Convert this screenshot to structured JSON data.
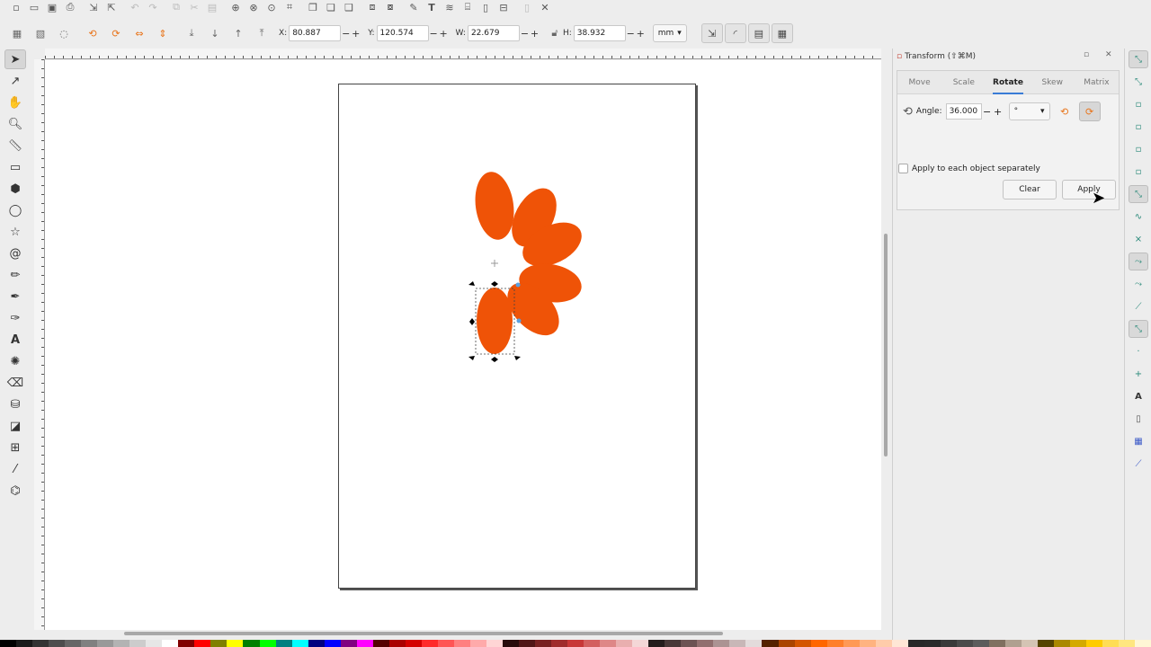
{
  "command_bar": {
    "icons": [
      "new-document-icon",
      "open-icon",
      "save-icon",
      "print-icon",
      "import-icon",
      "export-icon",
      "undo-icon",
      "redo-icon",
      "copy-icon",
      "cut-icon",
      "paste-icon",
      "zoom-selection-icon",
      "zoom-drawing-icon",
      "zoom-page-icon",
      "zoom-fit-icon",
      "duplicate-icon",
      "clone-icon",
      "unlink-clone-icon",
      "group-icon",
      "ungroup-icon",
      "xml-editor-icon",
      "text-font-icon",
      "layers-icon",
      "objects-icon",
      "fill-stroke-icon",
      "align-distribute-icon",
      "preferences-icon",
      "document-properties-icon"
    ]
  },
  "control_bar": {
    "x_label": "X:",
    "x_value": "80.887",
    "y_label": "Y:",
    "y_value": "120.574",
    "w_label": "W:",
    "w_value": "22.679",
    "h_label": "H:",
    "h_value": "38.932",
    "unit": "mm",
    "minus": "−",
    "plus": "+",
    "dropdown": "▾"
  },
  "transform_dialog": {
    "title": "Transform (⇧⌘M)",
    "tabs": [
      "Move",
      "Scale",
      "Rotate",
      "Skew",
      "Matrix"
    ],
    "active_tab": "Rotate",
    "angle_label": "Angle:",
    "angle_value": "36.000",
    "angle_unit": "°",
    "apply_separately_label": "Apply to each object separately",
    "clear_label": "Clear",
    "apply_label": "Apply"
  },
  "colors": {
    "shape_fill": "#ef5307",
    "accent": "#3a7cd6"
  },
  "palette": [
    "#000000",
    "#1a1a1a",
    "#333333",
    "#4d4d4d",
    "#666666",
    "#808080",
    "#999999",
    "#b3b3b3",
    "#cccccc",
    "#e6e6e6",
    "#ffffff",
    "#800000",
    "#ff0000",
    "#808000",
    "#ffff00",
    "#008000",
    "#00ff00",
    "#008080",
    "#00ffff",
    "#000080",
    "#0000ff",
    "#800080",
    "#ff00ff",
    "#550000",
    "#aa0000",
    "#d40000",
    "#ff2a2a",
    "#ff5555",
    "#ff8080",
    "#ffaaaa",
    "#ffd5d5",
    "#280b0b",
    "#501616",
    "#782121",
    "#a02c2c",
    "#c83737",
    "#d35f5f",
    "#de8787",
    "#e9afaf",
    "#f4d7d7",
    "#241c1c",
    "#483737",
    "#6c5353",
    "#916f6f",
    "#ac9393",
    "#c8b7b7",
    "#e3dbdb",
    "#552200",
    "#aa4400",
    "#d45500",
    "#ff6600",
    "#ff7f2a",
    "#ff9955",
    "#ffb380",
    "#ffccaa",
    "#ffe6d5",
    "#282828",
    "#2a2a2a",
    "#3a3a3a",
    "#4b4b4b",
    "#5c5c5c",
    "#807060",
    "#b0a090",
    "#d4c4b4",
    "#554400",
    "#aa8800",
    "#d4aa00",
    "#ffcc00",
    "#ffdd55",
    "#ffe680",
    "#fff6d5"
  ]
}
